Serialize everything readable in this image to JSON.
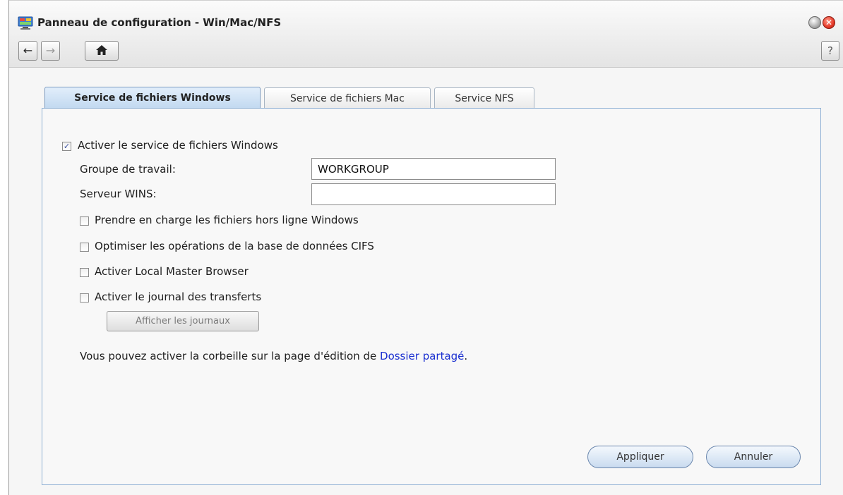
{
  "window": {
    "title": "Panneau de configuration - Win/Mac/NFS",
    "close_glyph": "✕"
  },
  "nav": {
    "back_icon": "←",
    "forward_icon": "→",
    "home_icon": "⌂",
    "help_label": "?"
  },
  "tabs": [
    {
      "label": "Service de fichiers Windows",
      "active": true
    },
    {
      "label": "Service de fichiers Mac",
      "active": false
    },
    {
      "label": "Service NFS",
      "active": false
    }
  ],
  "form": {
    "enable_windows": {
      "label": "Activer le service de fichiers Windows",
      "checked": true,
      "check_glyph": "✓"
    },
    "workgroup": {
      "label": "Groupe de travail:",
      "value": "WORKGROUP"
    },
    "wins": {
      "label": "Serveur WINS:",
      "value": ""
    },
    "offline_files": {
      "label": "Prendre en charge les fichiers hors ligne Windows",
      "checked": false
    },
    "optimize_cifs": {
      "label": "Optimiser les opérations de la base de données CIFS",
      "checked": false
    },
    "local_master": {
      "label": "Activer Local Master Browser",
      "checked": false
    },
    "transfer_log": {
      "label": "Activer le journal des transferts",
      "checked": false
    },
    "view_logs_button": "Afficher les journaux",
    "recycle_note_prefix": "Vous pouvez activer la corbeille sur la page d'édition de ",
    "recycle_note_link": "Dossier partagé",
    "recycle_note_suffix": "."
  },
  "actions": {
    "apply": "Appliquer",
    "cancel": "Annuler"
  },
  "colors": {
    "link": "#1a2fd0",
    "panel_border": "#8fb0d4"
  }
}
